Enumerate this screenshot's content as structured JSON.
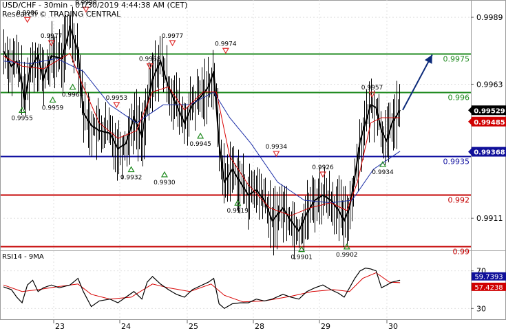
{
  "header": {
    "title": "USD/CHF - 30min - 01/30/2019 4:44:38 AM (CET)",
    "source": "Research © TRADING CENTRAL"
  },
  "rsi_header": "RSI14 - 9MA",
  "colors": {
    "price": "#000000",
    "ma_fast": "#d80000",
    "ma_slow": "#1c2fa8",
    "level_green": "#1e8a1e",
    "level_blue": "#1010a0",
    "level_red": "#c40000",
    "arrow": "#0c2a7a",
    "marker_down": "#e03030",
    "marker_up": "#1e8a1e",
    "rsi_line": "#000000",
    "rsi_ma": "#d80000",
    "grid": "#e0e0e0"
  },
  "chart_data": [
    {
      "type": "line",
      "pair": "USD/CHF",
      "timeframe": "30min",
      "ylim": [
        0.98985,
        0.99957
      ],
      "price_axis_ticks": [
        "0.9989",
        "0.9963",
        "0.9911"
      ],
      "x_tick_labels": [
        "23",
        "24",
        "25",
        "28",
        "29",
        "30"
      ],
      "levels": [
        {
          "value": 0.9975,
          "label": "0.9975",
          "color": "level_green"
        },
        {
          "value": 0.996,
          "label": "0.996",
          "color": "level_green"
        },
        {
          "value": 0.9935,
          "label": "0.9935",
          "color": "level_blue"
        },
        {
          "value": 0.992,
          "label": "0.992",
          "color": "level_red"
        },
        {
          "value": 0.99,
          "label": "0.99",
          "color": "level_red"
        }
      ],
      "price_badges": [
        {
          "value": 0.99529,
          "label": "0.99529",
          "style": "black"
        },
        {
          "value": 0.99485,
          "label": "0.99485",
          "style": "red"
        },
        {
          "value": 0.99368,
          "label": "0.99368",
          "style": "blue"
        }
      ],
      "close_series": [
        [
          0,
          0.9976
        ],
        [
          6,
          0.997
        ],
        [
          10,
          0.9972
        ],
        [
          14,
          0.9963
        ],
        [
          16,
          0.9957
        ],
        [
          20,
          0.9969
        ],
        [
          26,
          0.9974
        ],
        [
          30,
          0.9965
        ],
        [
          36,
          0.9974
        ],
        [
          44,
          0.9973
        ],
        [
          50,
          0.9985
        ],
        [
          56,
          0.9976
        ],
        [
          60,
          0.9952
        ],
        [
          66,
          0.9947
        ],
        [
          72,
          0.9945
        ],
        [
          80,
          0.9944
        ],
        [
          86,
          0.9938
        ],
        [
          92,
          0.994
        ],
        [
          98,
          0.995
        ],
        [
          104,
          0.9943
        ],
        [
          108,
          0.9955
        ],
        [
          112,
          0.9965
        ],
        [
          118,
          0.9972
        ],
        [
          124,
          0.9962
        ],
        [
          130,
          0.9955
        ],
        [
          136,
          0.9948
        ],
        [
          142,
          0.9955
        ],
        [
          148,
          0.9958
        ],
        [
          154,
          0.9962
        ],
        [
          158,
          0.9968
        ],
        [
          162,
          0.994
        ],
        [
          166,
          0.9925
        ],
        [
          172,
          0.993
        ],
        [
          178,
          0.9925
        ],
        [
          184,
          0.992
        ],
        [
          190,
          0.9922
        ],
        [
          196,
          0.9918
        ],
        [
          202,
          0.991
        ],
        [
          210,
          0.9915
        ],
        [
          216,
          0.991
        ],
        [
          222,
          0.9906
        ],
        [
          228,
          0.9913
        ],
        [
          234,
          0.9918
        ],
        [
          240,
          0.992
        ],
        [
          246,
          0.9918
        ],
        [
          252,
          0.9914
        ],
        [
          256,
          0.991
        ],
        [
          260,
          0.9915
        ],
        [
          264,
          0.9927
        ],
        [
          268,
          0.9941
        ],
        [
          272,
          0.9948
        ],
        [
          276,
          0.9955
        ],
        [
          280,
          0.9954
        ],
        [
          284,
          0.9945
        ],
        [
          288,
          0.9941
        ],
        [
          292,
          0.9948
        ],
        [
          298,
          0.9953
        ]
      ],
      "ma_fast_series": [
        [
          0,
          0.9974
        ],
        [
          14,
          0.997
        ],
        [
          30,
          0.9969
        ],
        [
          50,
          0.9975
        ],
        [
          60,
          0.9962
        ],
        [
          72,
          0.9948
        ],
        [
          86,
          0.9942
        ],
        [
          100,
          0.9945
        ],
        [
          112,
          0.996
        ],
        [
          124,
          0.9962
        ],
        [
          136,
          0.9953
        ],
        [
          150,
          0.996
        ],
        [
          160,
          0.996
        ],
        [
          170,
          0.9935
        ],
        [
          184,
          0.9924
        ],
        [
          200,
          0.9915
        ],
        [
          216,
          0.9912
        ],
        [
          230,
          0.9915
        ],
        [
          246,
          0.9917
        ],
        [
          258,
          0.9914
        ],
        [
          266,
          0.9925
        ],
        [
          276,
          0.9948
        ],
        [
          284,
          0.995
        ],
        [
          298,
          0.995
        ]
      ],
      "ma_slow_series": [
        [
          0,
          0.9972
        ],
        [
          20,
          0.9971
        ],
        [
          40,
          0.9973
        ],
        [
          60,
          0.9968
        ],
        [
          80,
          0.9955
        ],
        [
          100,
          0.9948
        ],
        [
          120,
          0.9955
        ],
        [
          140,
          0.9955
        ],
        [
          158,
          0.996
        ],
        [
          170,
          0.995
        ],
        [
          186,
          0.994
        ],
        [
          206,
          0.9925
        ],
        [
          226,
          0.9918
        ],
        [
          246,
          0.9917
        ],
        [
          262,
          0.9918
        ],
        [
          278,
          0.993
        ],
        [
          298,
          0.9937
        ]
      ],
      "forecast_arrow": {
        "from": [
          300,
          0.9953
        ],
        "to": [
          318,
          0.9975
        ]
      },
      "annotations": [
        {
          "text": "0.9986",
          "x": 18,
          "value": 0.9986,
          "marker": "down"
        },
        {
          "text": "0.9977",
          "x": 36,
          "value": 0.9977,
          "marker": "down"
        },
        {
          "text": "0.9990",
          "x": 62,
          "value": 0.999,
          "marker": "down"
        },
        {
          "text": "0.9977",
          "x": 127,
          "value": 0.9977,
          "marker": "down"
        },
        {
          "text": "0.9974",
          "x": 167,
          "value": 0.9974,
          "marker": "down"
        },
        {
          "text": "0.9968",
          "x": 110,
          "value": 0.9968,
          "marker": "down"
        },
        {
          "text": "0.9953",
          "x": 85,
          "value": 0.9953,
          "marker": "down"
        },
        {
          "text": "0.9934",
          "x": 205,
          "value": 0.9934,
          "marker": "down"
        },
        {
          "text": "0.9926",
          "x": 240,
          "value": 0.9926,
          "marker": "down"
        },
        {
          "text": "0.9957",
          "x": 277,
          "value": 0.9957,
          "marker": "down"
        },
        {
          "text": "0.9955",
          "x": 14,
          "value": 0.9955,
          "marker": "up"
        },
        {
          "text": "0.9959",
          "x": 37,
          "value": 0.9959,
          "marker": "up"
        },
        {
          "text": "0.9964",
          "x": 52,
          "value": 0.9964,
          "marker": "up"
        },
        {
          "text": "0.9945",
          "x": 148,
          "value": 0.9945,
          "marker": "up"
        },
        {
          "text": "0.9932",
          "x": 96,
          "value": 0.9932,
          "marker": "up"
        },
        {
          "text": "0.9930",
          "x": 121,
          "value": 0.993,
          "marker": "up"
        },
        {
          "text": "0.9919",
          "x": 176,
          "value": 0.9919,
          "marker": "up"
        },
        {
          "text": "0.9901",
          "x": 224,
          "value": 0.9901,
          "marker": "up"
        },
        {
          "text": "0.9902",
          "x": 258,
          "value": 0.9902,
          "marker": "up"
        },
        {
          "text": "0.9934",
          "x": 285,
          "value": 0.9934,
          "marker": "up"
        }
      ]
    },
    {
      "type": "line",
      "name": "RSI14 - 9MA",
      "ylim": [
        20,
        80
      ],
      "y_ticks": [
        "70",
        "30"
      ],
      "value_badges": [
        {
          "value": 59.7393,
          "label": "59.7393",
          "style": "blue"
        },
        {
          "value": 57.4238,
          "label": "57.4238",
          "style": "red"
        }
      ],
      "rsi_series": [
        [
          0,
          53
        ],
        [
          6,
          50
        ],
        [
          10,
          42
        ],
        [
          14,
          36
        ],
        [
          18,
          55
        ],
        [
          22,
          60
        ],
        [
          26,
          48
        ],
        [
          30,
          52
        ],
        [
          36,
          55
        ],
        [
          42,
          52
        ],
        [
          50,
          55
        ],
        [
          56,
          62
        ],
        [
          60,
          48
        ],
        [
          66,
          32
        ],
        [
          72,
          38
        ],
        [
          80,
          40
        ],
        [
          86,
          36
        ],
        [
          92,
          42
        ],
        [
          98,
          48
        ],
        [
          104,
          40
        ],
        [
          108,
          58
        ],
        [
          112,
          64
        ],
        [
          118,
          56
        ],
        [
          124,
          50
        ],
        [
          130,
          45
        ],
        [
          136,
          42
        ],
        [
          142,
          50
        ],
        [
          148,
          54
        ],
        [
          154,
          58
        ],
        [
          158,
          62
        ],
        [
          162,
          35
        ],
        [
          166,
          30
        ],
        [
          172,
          35
        ],
        [
          178,
          36
        ],
        [
          184,
          36
        ],
        [
          190,
          40
        ],
        [
          196,
          38
        ],
        [
          202,
          40
        ],
        [
          210,
          45
        ],
        [
          216,
          42
        ],
        [
          222,
          40
        ],
        [
          228,
          48
        ],
        [
          234,
          52
        ],
        [
          240,
          55
        ],
        [
          246,
          50
        ],
        [
          252,
          46
        ],
        [
          256,
          42
        ],
        [
          260,
          52
        ],
        [
          264,
          62
        ],
        [
          268,
          70
        ],
        [
          272,
          73
        ],
        [
          276,
          72
        ],
        [
          280,
          70
        ],
        [
          284,
          52
        ],
        [
          288,
          55
        ],
        [
          292,
          58
        ],
        [
          298,
          60
        ]
      ],
      "rsi_ma_series": [
        [
          0,
          55
        ],
        [
          14,
          48
        ],
        [
          26,
          50
        ],
        [
          40,
          53
        ],
        [
          56,
          56
        ],
        [
          66,
          45
        ],
        [
          80,
          40
        ],
        [
          96,
          42
        ],
        [
          112,
          56
        ],
        [
          124,
          52
        ],
        [
          140,
          48
        ],
        [
          156,
          56
        ],
        [
          166,
          44
        ],
        [
          180,
          37
        ],
        [
          196,
          38
        ],
        [
          216,
          43
        ],
        [
          232,
          48
        ],
        [
          248,
          50
        ],
        [
          260,
          48
        ],
        [
          270,
          62
        ],
        [
          280,
          68
        ],
        [
          290,
          58
        ],
        [
          298,
          57.4
        ]
      ]
    }
  ]
}
